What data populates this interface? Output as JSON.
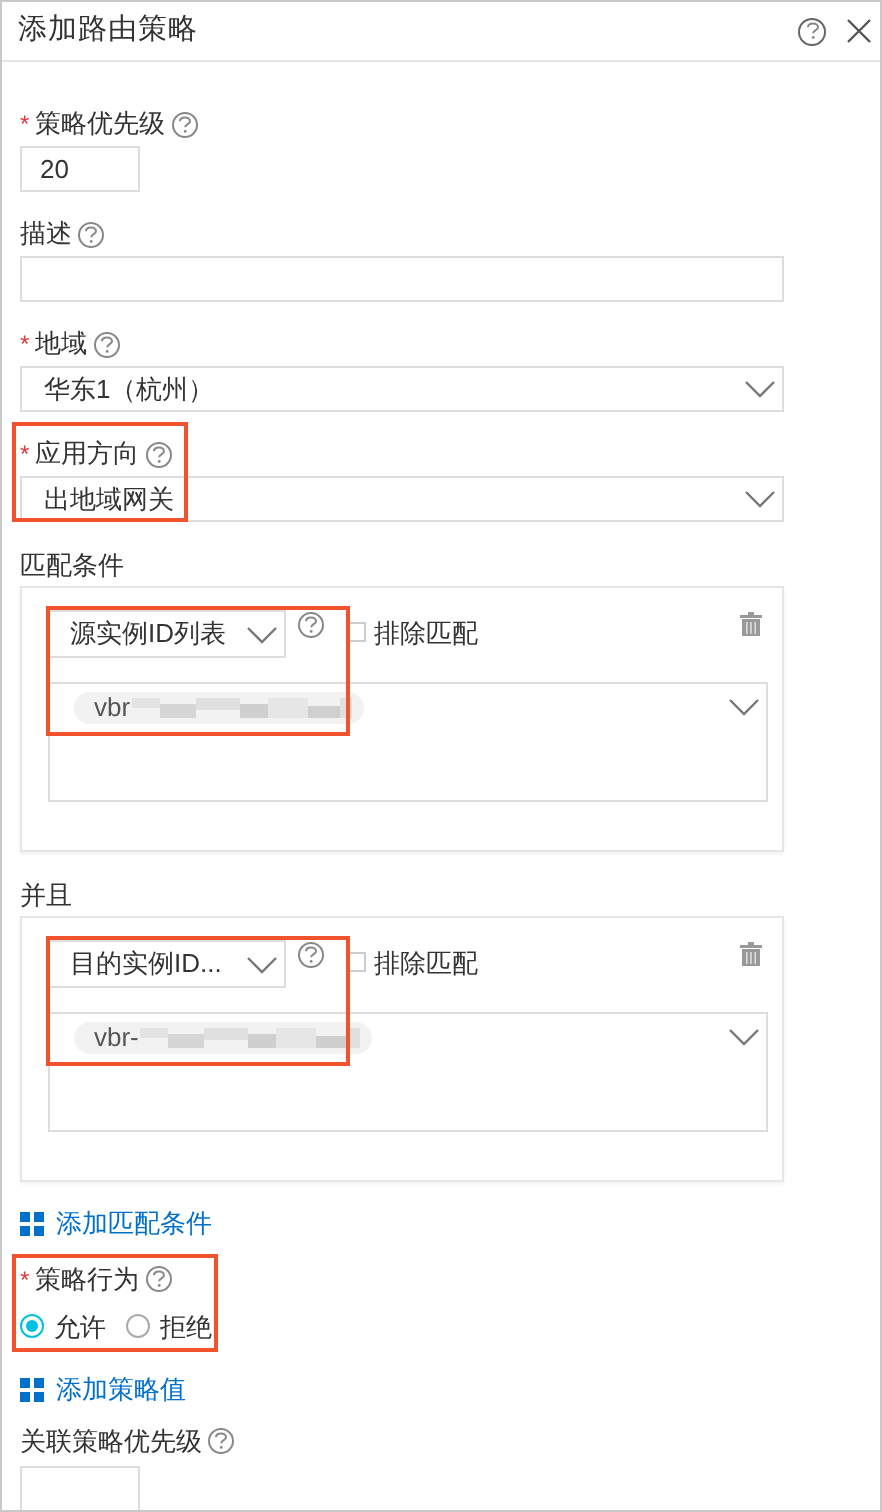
{
  "window": {
    "title": "添加路由策略"
  },
  "fields": [
    {
      "kind": "input",
      "label": "策略优先级",
      "required_mark": "*",
      "value": "20"
    },
    {
      "kind": "wide-input",
      "label": "描述"
    },
    {
      "kind": "select",
      "label": "地域",
      "required_mark": "*",
      "value": "华东1（杭州）"
    },
    {
      "kind": "select",
      "label": "应用方向",
      "required_mark": "*",
      "value": "出地域网关",
      "highlighted": true
    }
  ],
  "conditions": [
    {
      "heading": "匹配条件",
      "type": "源实例ID列表",
      "exclude_label": "排除匹配",
      "exclude_checked": false,
      "tags": [
        "vbr"
      ],
      "highlighted": true
    },
    {
      "heading": "并且",
      "type": "目的实例ID...",
      "exclude_label": "排除匹配",
      "exclude_checked": false,
      "tags": [
        "vbr-"
      ],
      "highlighted": true
    }
  ],
  "add_condition": "添加匹配条件",
  "action": {
    "label": "策略行为",
    "required_mark": "*",
    "highlighted": true,
    "options": [
      {
        "label": "允许",
        "selected": true
      },
      {
        "label": "拒绝",
        "selected": false
      }
    ]
  },
  "add_value": "添加策略值",
  "linked_priority": {
    "label": "关联策略优先级"
  }
}
